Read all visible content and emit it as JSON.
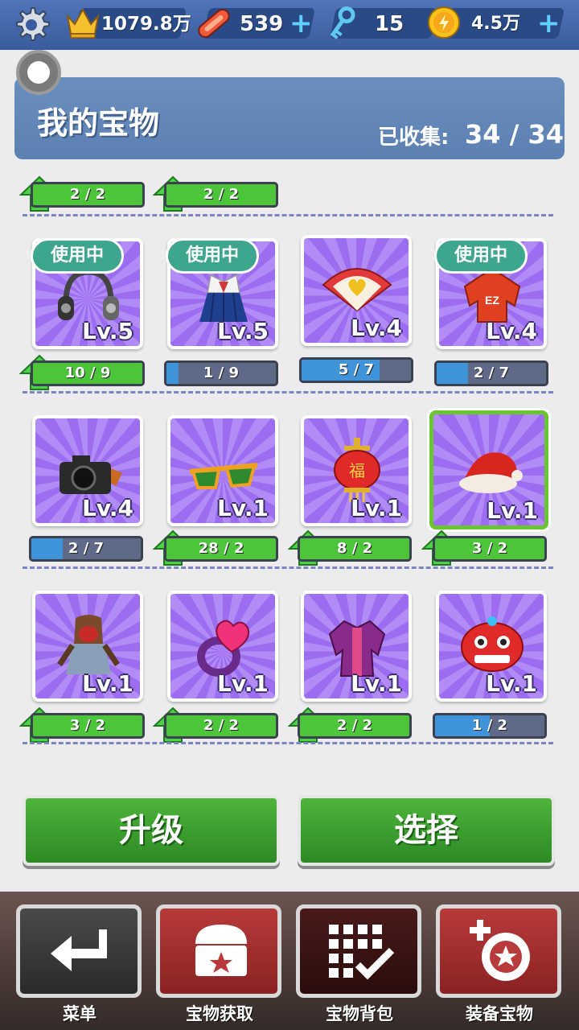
{
  "topbar": {
    "score": "1079.8万",
    "boards": "539",
    "keys": "15",
    "coins": "4.5万",
    "plus": "+"
  },
  "header": {
    "title": "我的宝物",
    "collected_label": "已收集:",
    "collected_value": "34 / 34"
  },
  "row0_bars": [
    {
      "text": "2 / 2"
    },
    {
      "text": "2 / 2"
    }
  ],
  "items": [
    {
      "name": "headphones",
      "level": "Lv.5",
      "in_use": "使用中",
      "progress": "10 / 9",
      "fill": 1.0
    },
    {
      "name": "school-uniform",
      "level": "Lv.5",
      "in_use": "使用中",
      "progress": "1 / 9",
      "fill": 0.11
    },
    {
      "name": "heart-fan",
      "level": "Lv.4",
      "progress": "5 / 7",
      "fill": 0.71
    },
    {
      "name": "red-hoodie",
      "level": "Lv.4",
      "in_use": "使用中",
      "progress": "2 / 7",
      "fill": 0.29
    },
    {
      "name": "camera",
      "level": "Lv.4",
      "progress": "2 / 7",
      "fill": 0.29
    },
    {
      "name": "sunglasses",
      "level": "Lv.1",
      "progress": "28 / 2",
      "fill": 1.0
    },
    {
      "name": "red-lantern",
      "level": "Lv.1",
      "progress": "8 / 2",
      "fill": 1.0
    },
    {
      "name": "santa-hat",
      "level": "Lv.1",
      "progress": "3 / 2",
      "fill": 1.0
    },
    {
      "name": "hooded-figure",
      "level": "Lv.1",
      "progress": "3 / 2",
      "fill": 1.0
    },
    {
      "name": "heart-ring",
      "level": "Lv.1",
      "progress": "2 / 2",
      "fill": 1.0
    },
    {
      "name": "purple-jacket",
      "level": "Lv.1",
      "progress": "2 / 2",
      "fill": 1.0
    },
    {
      "name": "lion-dance-head",
      "level": "Lv.1",
      "progress": "1 / 2",
      "fill": 0.5
    }
  ],
  "actions": {
    "upgrade": "升级",
    "select": "选择"
  },
  "nav": {
    "menu": "菜单",
    "acquire": "宝物获取",
    "backpack": "宝物背包",
    "equip": "装备宝物"
  },
  "colors": {
    "accent_green": "#4cc53a",
    "progress_blue": "#3f93d9",
    "card_purple": "#9c6df0"
  }
}
